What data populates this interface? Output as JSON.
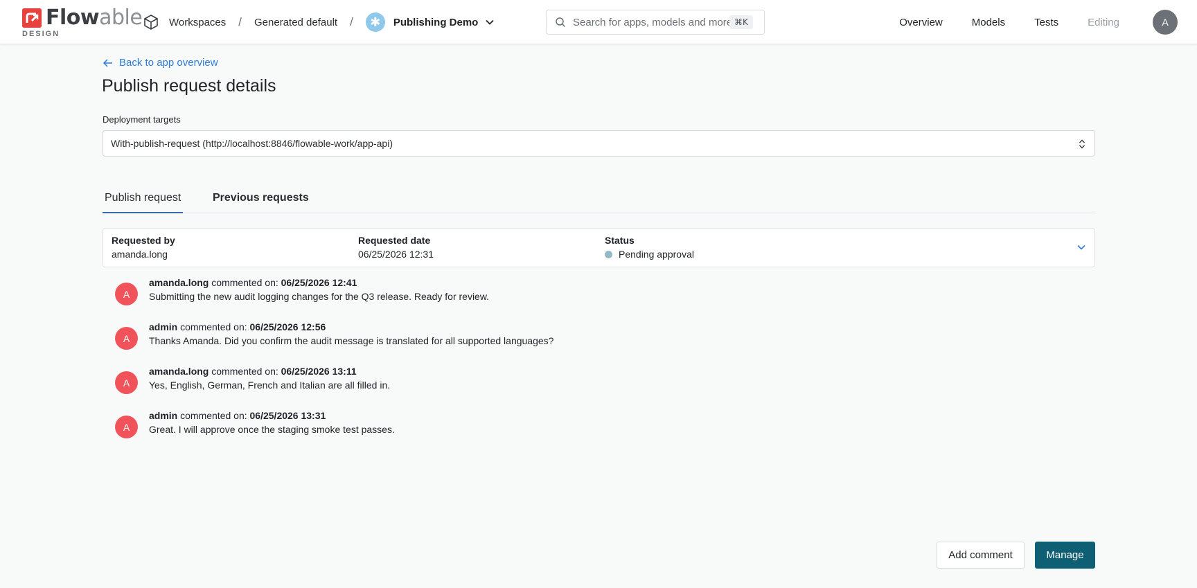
{
  "header": {
    "logo_text_bold": "Flow",
    "logo_text_light": "able",
    "logo_subtitle": "DESIGN",
    "breadcrumb": {
      "workspaces": "Workspaces",
      "workspace": "Generated default",
      "app": "Publishing Demo"
    },
    "search": {
      "placeholder": "Search for apps, models and more",
      "shortcut": "⌘K"
    },
    "nav": [
      "Overview",
      "Models",
      "Tests",
      "Editing"
    ],
    "avatar_initial": "A",
    "icons": {
      "cube": "cube-icon",
      "app": "asterisk-icon",
      "chevron": "chevron-down-icon",
      "search": "search-icon"
    }
  },
  "main": {
    "back_link": "Back to app overview",
    "title": "Publish request details",
    "deployment": {
      "label": "Deployment targets",
      "selected": "With-publish-request (http://localhost:8846/flowable-work/app-api)"
    },
    "tabs": [
      "Publish request",
      "Previous requests"
    ],
    "summary": {
      "requested_by_label": "Requested by",
      "requested_by": "amanda.long",
      "requested_date_label": "Requested date",
      "requested_date": "06/25/2026 12:31",
      "status_label": "Status",
      "status": "Pending approval",
      "status_color": "#94b8c5"
    },
    "comments": [
      {
        "initial": "A",
        "author": "amanda.long",
        "verb": "commented on:",
        "date": "06/25/2026 12:41",
        "text": "Submitting the new audit logging changes for the Q3 release. Ready for review."
      },
      {
        "initial": "A",
        "author": "admin",
        "verb": "commented on:",
        "date": "06/25/2026 12:56",
        "text": "Thanks Amanda. Did you confirm the audit message is translated for all supported languages?"
      },
      {
        "initial": "A",
        "author": "amanda.long",
        "verb": "commented on:",
        "date": "06/25/2026 13:11",
        "text": "Yes, English, German, French and Italian are all filled in."
      },
      {
        "initial": "A",
        "author": "admin",
        "verb": "commented on:",
        "date": "06/25/2026 13:31",
        "text": "Great. I will approve once the staging smoke test passes."
      }
    ],
    "actions": {
      "add_comment": "Add comment",
      "manage": "Manage"
    }
  },
  "colors": {
    "brand": "#e8423f",
    "primary_button": "#0e5f74",
    "link": "#2b7bd8",
    "comment_avatar": "#f0535a"
  }
}
